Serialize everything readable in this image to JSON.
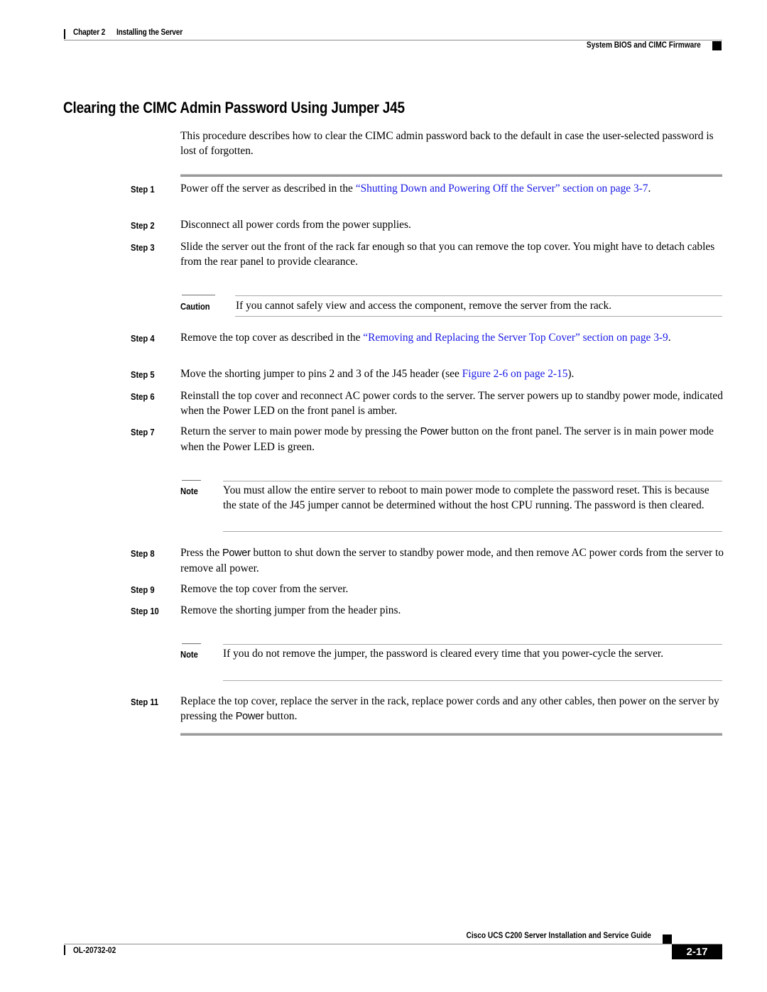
{
  "header": {
    "chapter": "Chapter 2",
    "chapter_title": "Installing the Server",
    "section": "System BIOS and CIMC Firmware"
  },
  "title": "Clearing the CIMC Admin Password Using Jumper J45",
  "intro": "This procedure describes how to clear the CIMC admin password back to the default in case the user-selected password is lost of forgotten.",
  "steps": [
    {
      "label": "Step 1",
      "pre": "Power off the server as described in the ",
      "link": "“Shutting Down and Powering Off the Server” section on page 3-7",
      "post": "."
    },
    {
      "label": "Step 2",
      "text": "Disconnect all power cords from the power supplies."
    },
    {
      "label": "Step 3",
      "text": "Slide the server out the front of the rack far enough so that you can remove the top cover. You might have to detach cables from the rear panel to provide clearance."
    },
    {
      "label": "Step 4",
      "pre": "Remove the top cover as described in the ",
      "link": "“Removing and Replacing the Server Top Cover” section on page 3-9",
      "post": "."
    },
    {
      "label": "Step 5",
      "pre": "Move the shorting jumper to pins 2 and 3 of the J45 header (see ",
      "link": "Figure 2-6 on page 2-15",
      "post": ")."
    },
    {
      "label": "Step 6",
      "text": "Reinstall the top cover and reconnect AC power cords to the server. The server powers up to standby power mode, indicated when the Power LED on the front panel is amber."
    },
    {
      "label": "Step 7",
      "pre": "Return the server to main power mode by pressing the ",
      "key": "Power",
      "post": " button on the front panel. The server is in main power mode when the Power LED is green."
    },
    {
      "label": "Step 8",
      "pre": "Press the ",
      "key": "Power",
      "post": " button to shut down the server to standby power mode, and then remove AC power cords from the server to remove all power."
    },
    {
      "label": "Step 9",
      "text": "Remove the top cover from the server."
    },
    {
      "label": "Step 10",
      "text": "Remove the shorting jumper from the header pins."
    },
    {
      "label": "Step 11",
      "pre": "Replace the top cover, replace the server in the rack, replace power cords and any other cables, then power on the server by pressing the ",
      "key": "Power",
      "post": " button."
    }
  ],
  "callouts": {
    "caution": {
      "label": "Caution",
      "text": "If you cannot safely view and access the component, remove the server from the rack."
    },
    "note1": {
      "label": "Note",
      "text": "You must allow the entire server to reboot to main power mode to complete the password reset. This is because the state of the J45 jumper cannot be determined without the host CPU running. The password is then cleared."
    },
    "note2": {
      "label": "Note",
      "text": "If you do not remove the jumper, the password is cleared every time that you power-cycle the server."
    }
  },
  "footer": {
    "guide_title": "Cisco UCS C200 Server Installation and Service Guide",
    "doc_number": "OL-20732-02",
    "page_number": "2-17"
  },
  "colors": {
    "link": "#1a1ae6",
    "rule": "#9a9a9a"
  }
}
